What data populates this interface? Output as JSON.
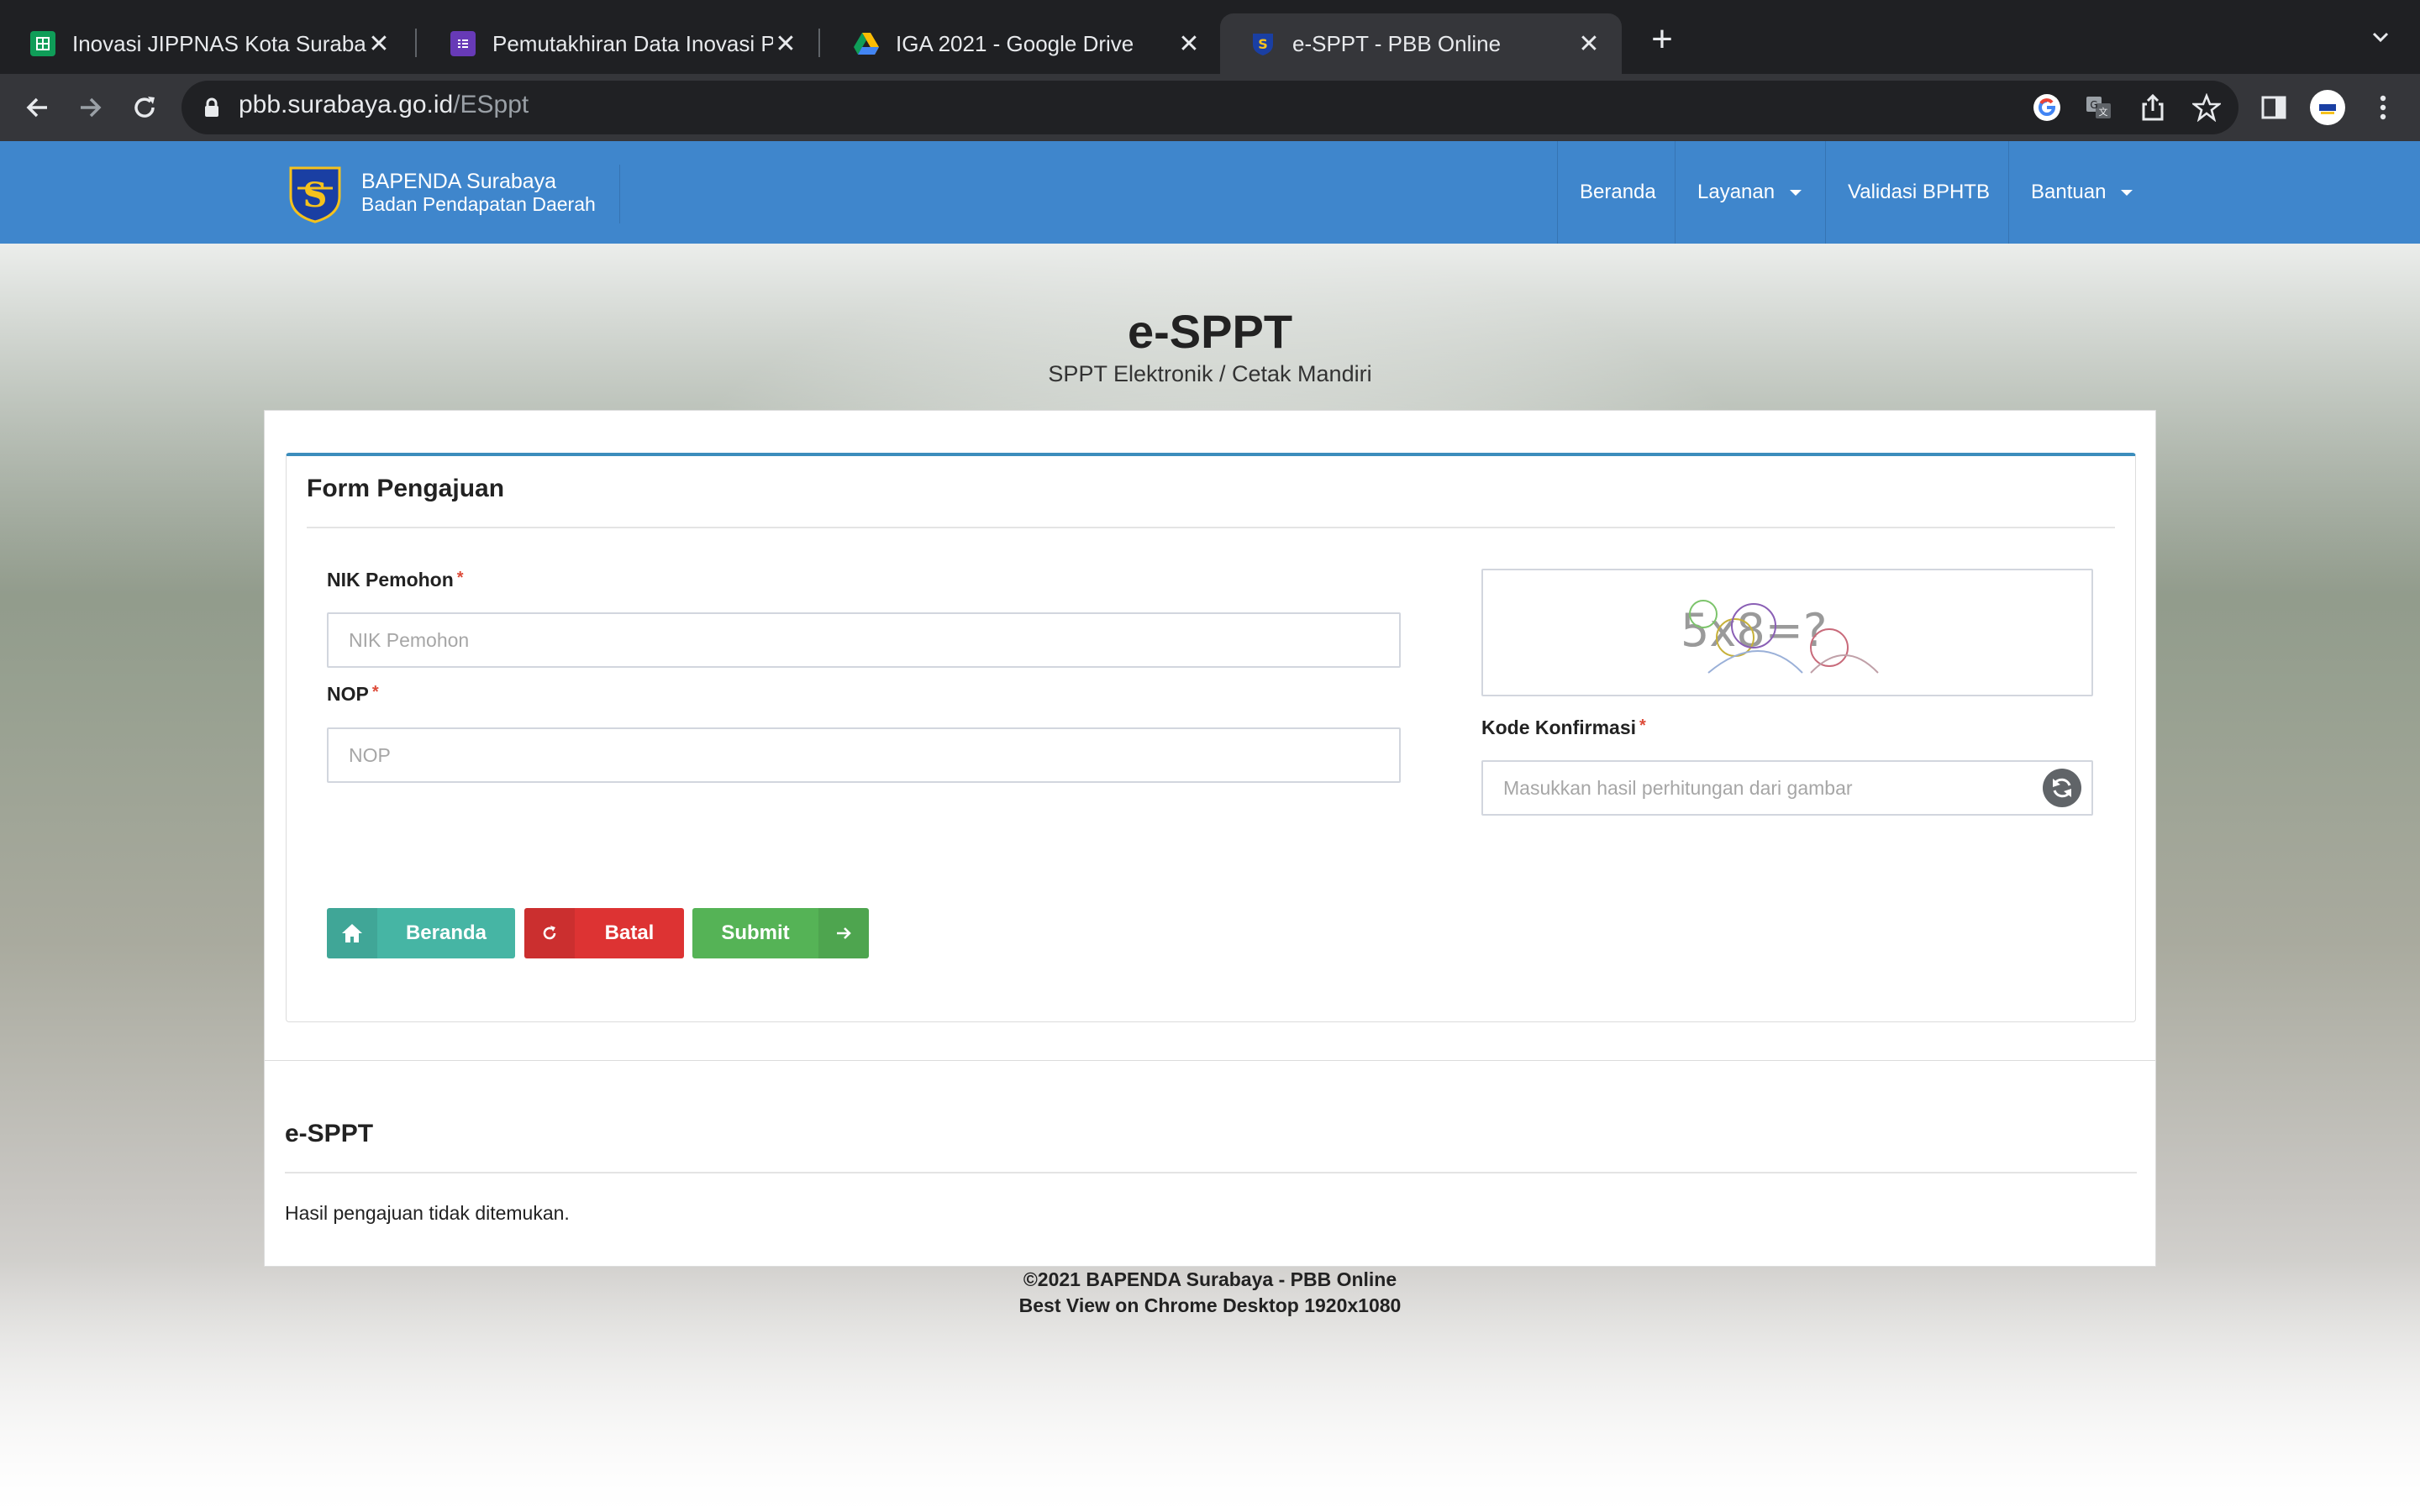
{
  "browser": {
    "tabs": [
      {
        "title": "Inovasi JIPPNAS Kota Surabaya",
        "icon": "google-sheets-icon",
        "active": false
      },
      {
        "title": "Pemutakhiran Data Inovasi Pelayanan",
        "icon": "google-forms-icon",
        "active": false
      },
      {
        "title": "IGA 2021 - Google Drive",
        "icon": "google-drive-icon",
        "active": false
      },
      {
        "title": "e-SPPT - PBB Online",
        "icon": "surabaya-emblem-icon",
        "active": true
      }
    ],
    "close_glyph": "✕",
    "new_tab_glyph": "+",
    "url_host": "pbb.surabaya.go.id",
    "url_path": "/ESppt"
  },
  "navbar": {
    "brand_title": "BAPENDA Surabaya",
    "brand_subtitle": "Badan Pendapatan Daerah",
    "menu": [
      {
        "label": "Beranda",
        "has_caret": false
      },
      {
        "label": "Layanan",
        "has_caret": true
      },
      {
        "label": "Validasi BPHTB",
        "has_caret": false
      },
      {
        "label": "Bantuan",
        "has_caret": true
      }
    ],
    "bg_color": "#3f86cc"
  },
  "hero": {
    "title": "e-SPPT",
    "subtitle": "SPPT Elektronik / Cetak Mandiri"
  },
  "form": {
    "title": "Form Pengajuan",
    "nik_label": "NIK Pemohon",
    "nik_placeholder": "NIK Pemohon",
    "nop_label": "NOP",
    "nop_placeholder": "NOP",
    "captcha_label": "Kode Konfirmasi",
    "captcha_placeholder": "Masukkan hasil perhitungan dari gambar",
    "captcha_text": "5x8=?",
    "required_mark": "*",
    "buttons": [
      {
        "label": "Beranda",
        "icon": "home-icon",
        "color": "#46b5a4"
      },
      {
        "label": "Batal",
        "icon": "refresh-icon",
        "color": "#dd3333"
      },
      {
        "label": "Submit",
        "icon": "arrow-right-icon",
        "color": "#55b356"
      }
    ]
  },
  "results": {
    "title": "e-SPPT",
    "message": "Hasil pengajuan tidak ditemukan."
  },
  "footer": {
    "line1": "©2021 BAPENDA Surabaya - PBB Online",
    "line2": "Best View on Chrome Desktop 1920x1080"
  }
}
